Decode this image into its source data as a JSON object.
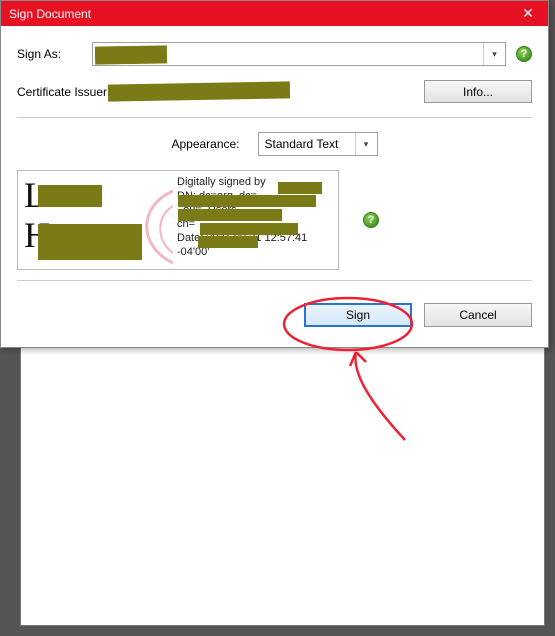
{
  "window": {
    "title": "Sign Document",
    "close_glyph": "✕"
  },
  "form": {
    "sign_as_label": "Sign As:",
    "sign_as_value": "",
    "issuer_label": "Certificate Issuer:",
    "issuer_value": "",
    "info_button": "Info...",
    "help_glyph": "?",
    "appearance_label": "Appearance:",
    "appearance_value": "Standard Text",
    "caret_glyph": "▾"
  },
  "preview": {
    "left_line1": "L",
    "left_line2": "H",
    "right_line_signed_by": "Digitally signed by",
    "right_line_dn_prefix": "DN: dc=org, dc=",
    "right_line_ou": ", ou=",
    "right_line_users": ", Users,",
    "right_line_cn": "cn=",
    "right_line_date": "Date: 2021.09.21 12:57:41",
    "right_line_tz": "-04'00'"
  },
  "actions": {
    "sign": "Sign",
    "cancel": "Cancel"
  },
  "colors": {
    "titlebar": "#e81123",
    "primary_border": "#2a74d1",
    "redaction": "#7a7a17",
    "annotation": "#e23"
  }
}
